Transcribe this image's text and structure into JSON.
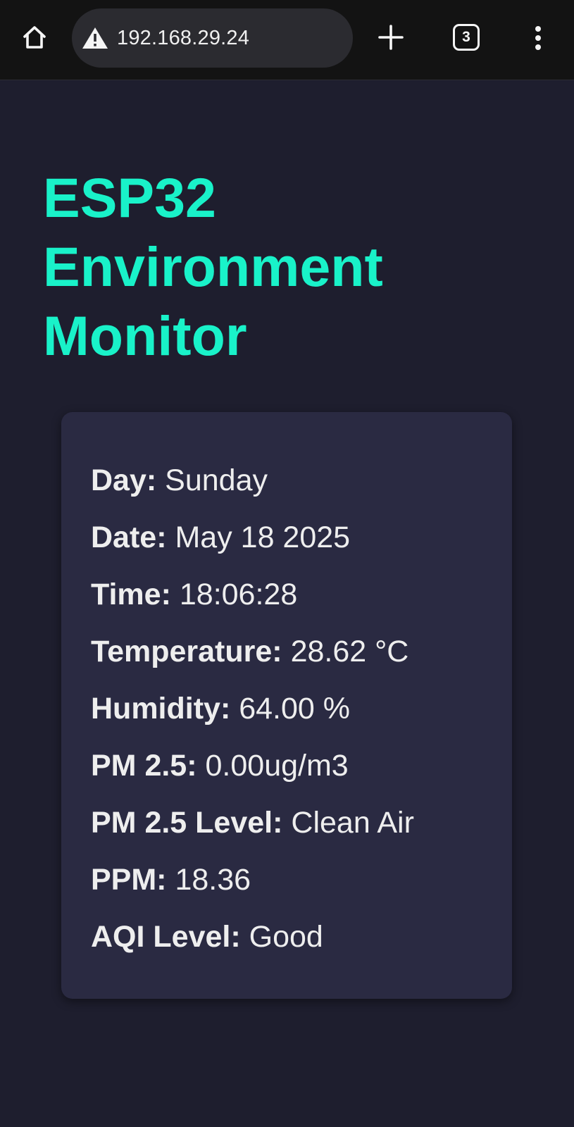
{
  "browser": {
    "url": "192.168.29.24",
    "tab_count": "3",
    "icons": {
      "home": "home-icon",
      "warning": "warning-icon",
      "new_tab": "plus-icon",
      "menu": "more-vertical-icon"
    }
  },
  "page": {
    "title_lines": [
      "ESP32",
      "Environment",
      "Monitor"
    ],
    "readings": [
      {
        "label": "Day:",
        "value": "Sunday"
      },
      {
        "label": "Date:",
        "value": "May 18 2025"
      },
      {
        "label": "Time:",
        "value": "18:06:28"
      },
      {
        "label": "Temperature:",
        "value": "28.62 °C"
      },
      {
        "label": "Humidity:",
        "value": "64.00 %"
      },
      {
        "label": "PM 2.5:",
        "value": "0.00ug/m3"
      },
      {
        "label": "PM 2.5 Level:",
        "value": "Clean Air"
      },
      {
        "label": "PPM:",
        "value": "18.36"
      },
      {
        "label": "AQI Level:",
        "value": "Good"
      }
    ]
  },
  "colors": {
    "background": "#1e1e2e",
    "card": "#2a2a42",
    "accent": "#19f2c9",
    "text": "#eeeeee",
    "toolbar": "#131313"
  }
}
